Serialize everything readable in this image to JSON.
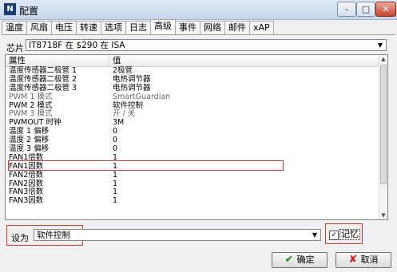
{
  "window": {
    "title": "配置",
    "app_icon_text": "N"
  },
  "tabs": [
    "温度",
    "风扇",
    "电压",
    "转速",
    "选项",
    "日志",
    "高级",
    "事件",
    "网络",
    "邮件",
    "xAP"
  ],
  "active_tab": "高级",
  "chip": {
    "label": "芯片",
    "value": "IT8718F 在 $290 在 ISA"
  },
  "list": {
    "headers": {
      "property": "属性",
      "value": "值"
    },
    "rows": [
      {
        "k": "温度传感器二极管 1",
        "v": "2极管"
      },
      {
        "k": "温度传感器二极管 2",
        "v": "电热调节器"
      },
      {
        "k": "温度传感器二极管 3",
        "v": "电热调节器"
      },
      {
        "k": "PWM 1 模式",
        "v": "SmartGuardian"
      },
      {
        "k": "PWM 2 模式",
        "v": "软件控制"
      },
      {
        "k": "PWM 3 模式",
        "v": "开 / 关"
      },
      {
        "k": "PWMOUT 时钟",
        "v": "3M"
      },
      {
        "k": "温度 1 偏移",
        "v": "0"
      },
      {
        "k": "温度 2 偏移",
        "v": "0"
      },
      {
        "k": "温度 3 偏移",
        "v": "0"
      },
      {
        "k": "FAN1倍数",
        "v": "1"
      },
      {
        "k": "FAN1因数",
        "v": "1"
      },
      {
        "k": "FAN2倍数",
        "v": "1"
      },
      {
        "k": "FAN2因数",
        "v": "1"
      },
      {
        "k": "FAN3倍数",
        "v": "1"
      },
      {
        "k": "FAN3因数",
        "v": "1"
      }
    ]
  },
  "set_as": {
    "label": "设为",
    "value": "软件控制"
  },
  "memory": {
    "checked": true,
    "label": "记忆"
  },
  "buttons": {
    "ok": "确定",
    "cancel": "取消"
  }
}
